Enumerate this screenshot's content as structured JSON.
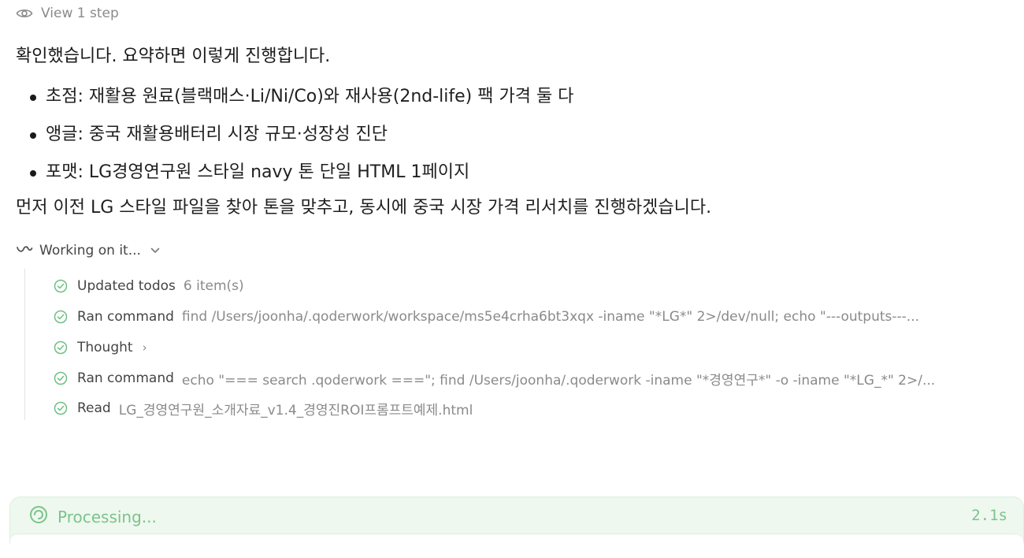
{
  "view_step": {
    "icon": "eye-icon",
    "label": "View 1 step"
  },
  "message": {
    "intro": "확인했습니다. 요약하면 이렇게 진행합니다.",
    "bullets": [
      "초점: 재활용 원료(블랙매스·Li/Ni/Co)와 재사용(2nd-life) 팩 가격 둘 다",
      "앵글: 중국 재활용배터리 시장 규모·성장성 진단",
      "포맷: LG경영연구원 스타일 navy 톤 단일 HTML 1페이지"
    ],
    "outro": "먼저 이전 LG 스타일 파일을 찾아 톤을 맞추고, 동시에 중국 시장 가격 리서치를 진행하겠습니다."
  },
  "working": {
    "icon": "loader-squiggle-icon",
    "label": "Working on it...",
    "toggle_icon": "chevron-down-icon"
  },
  "steps": [
    {
      "label": "Updated todos",
      "detail": "6 item(s)"
    },
    {
      "label": "Ran command",
      "detail": "find /Users/joonha/.qoderwork/workspace/ms5e4crha6bt3xqx -iname \"*LG*\" 2>/dev/null; echo \"---outputs---..."
    },
    {
      "label": "Thought",
      "detail": "›"
    },
    {
      "label": "Ran command",
      "detail": "echo \"=== search .qoderwork ===\"; find /Users/joonha/.qoderwork -iname \"*경영연구*\" -o -iname \"*LG_*\" 2>/..."
    },
    {
      "label": "Read",
      "detail": "LG_경영연구원_소개자료_v1.4_경영진ROI프롬프트예제.html"
    }
  ],
  "processing": {
    "icon": "spinner-icon",
    "label": "Processing...",
    "time": "2.1s",
    "accent_color": "#7cc38a",
    "background_color": "#eef8ef"
  }
}
